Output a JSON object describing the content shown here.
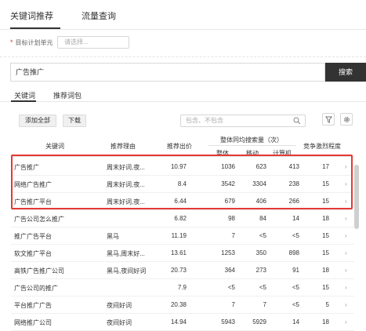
{
  "top_tabs": [
    {
      "label": "关键词推荐",
      "active": true
    },
    {
      "label": "流量查询",
      "active": false
    }
  ],
  "unit": {
    "required_mark": "*",
    "label": "目标计划单元",
    "placeholder": "请选择..."
  },
  "search": {
    "value": "广告推广",
    "button": "搜索"
  },
  "sub_tabs": [
    {
      "label": "关键词",
      "active": true
    },
    {
      "label": "推荐词包",
      "active": false
    }
  ],
  "actions": {
    "add_all": "添加全部",
    "download": "下载"
  },
  "filter": {
    "placeholder": "包含、不包含"
  },
  "icons": {
    "search": "search-icon",
    "filter": "filter-icon",
    "settings": "gear-icon",
    "row": "chevron-right-icon"
  },
  "colors": {
    "highlight": "#e53935",
    "search_button": "#333333"
  },
  "table": {
    "headers": {
      "keyword": "关键词",
      "reason": "推荐理由",
      "bid": "推荐出价",
      "search_group": "整体同均搜索量（次）",
      "overall": "整体",
      "mobile": "移动",
      "pc": "计算机",
      "competition": "竞争激烈程度"
    },
    "rows": [
      {
        "keyword": "广告推广",
        "reason": "周末好词,夜...",
        "bid": "10.97",
        "overall": "1036",
        "mobile": "623",
        "pc": "413",
        "competition": "17"
      },
      {
        "keyword": "网络广告推广",
        "reason": "周末好词,夜...",
        "bid": "8.4",
        "overall": "3542",
        "mobile": "3304",
        "pc": "238",
        "competition": "15"
      },
      {
        "keyword": "广告推广平台",
        "reason": "周末好词,夜...",
        "bid": "6.44",
        "overall": "679",
        "mobile": "406",
        "pc": "266",
        "competition": "15"
      },
      {
        "keyword": "广告公司怎么推广",
        "reason": "",
        "bid": "6.82",
        "overall": "98",
        "mobile": "84",
        "pc": "14",
        "competition": "18"
      },
      {
        "keyword": "推广广告平台",
        "reason": "黑马",
        "bid": "11.19",
        "overall": "7",
        "mobile": "<5",
        "pc": "<5",
        "competition": "15"
      },
      {
        "keyword": "软文推广平台",
        "reason": "黑马,周末好...",
        "bid": "13.61",
        "overall": "1253",
        "mobile": "350",
        "pc": "898",
        "competition": "15"
      },
      {
        "keyword": "高铁广告推广公司",
        "reason": "黑马,夜间好词",
        "bid": "20.73",
        "overall": "364",
        "mobile": "273",
        "pc": "91",
        "competition": "18"
      },
      {
        "keyword": "广告公司的推广",
        "reason": "",
        "bid": "7.9",
        "overall": "<5",
        "mobile": "<5",
        "pc": "<5",
        "competition": "15"
      },
      {
        "keyword": "平台推广广告",
        "reason": "夜间好词",
        "bid": "20.38",
        "overall": "7",
        "mobile": "7",
        "pc": "<5",
        "competition": "5"
      },
      {
        "keyword": "网络推广公司",
        "reason": "夜间好词",
        "bid": "14.94",
        "overall": "5943",
        "mobile": "5929",
        "pc": "14",
        "competition": "18"
      }
    ]
  }
}
